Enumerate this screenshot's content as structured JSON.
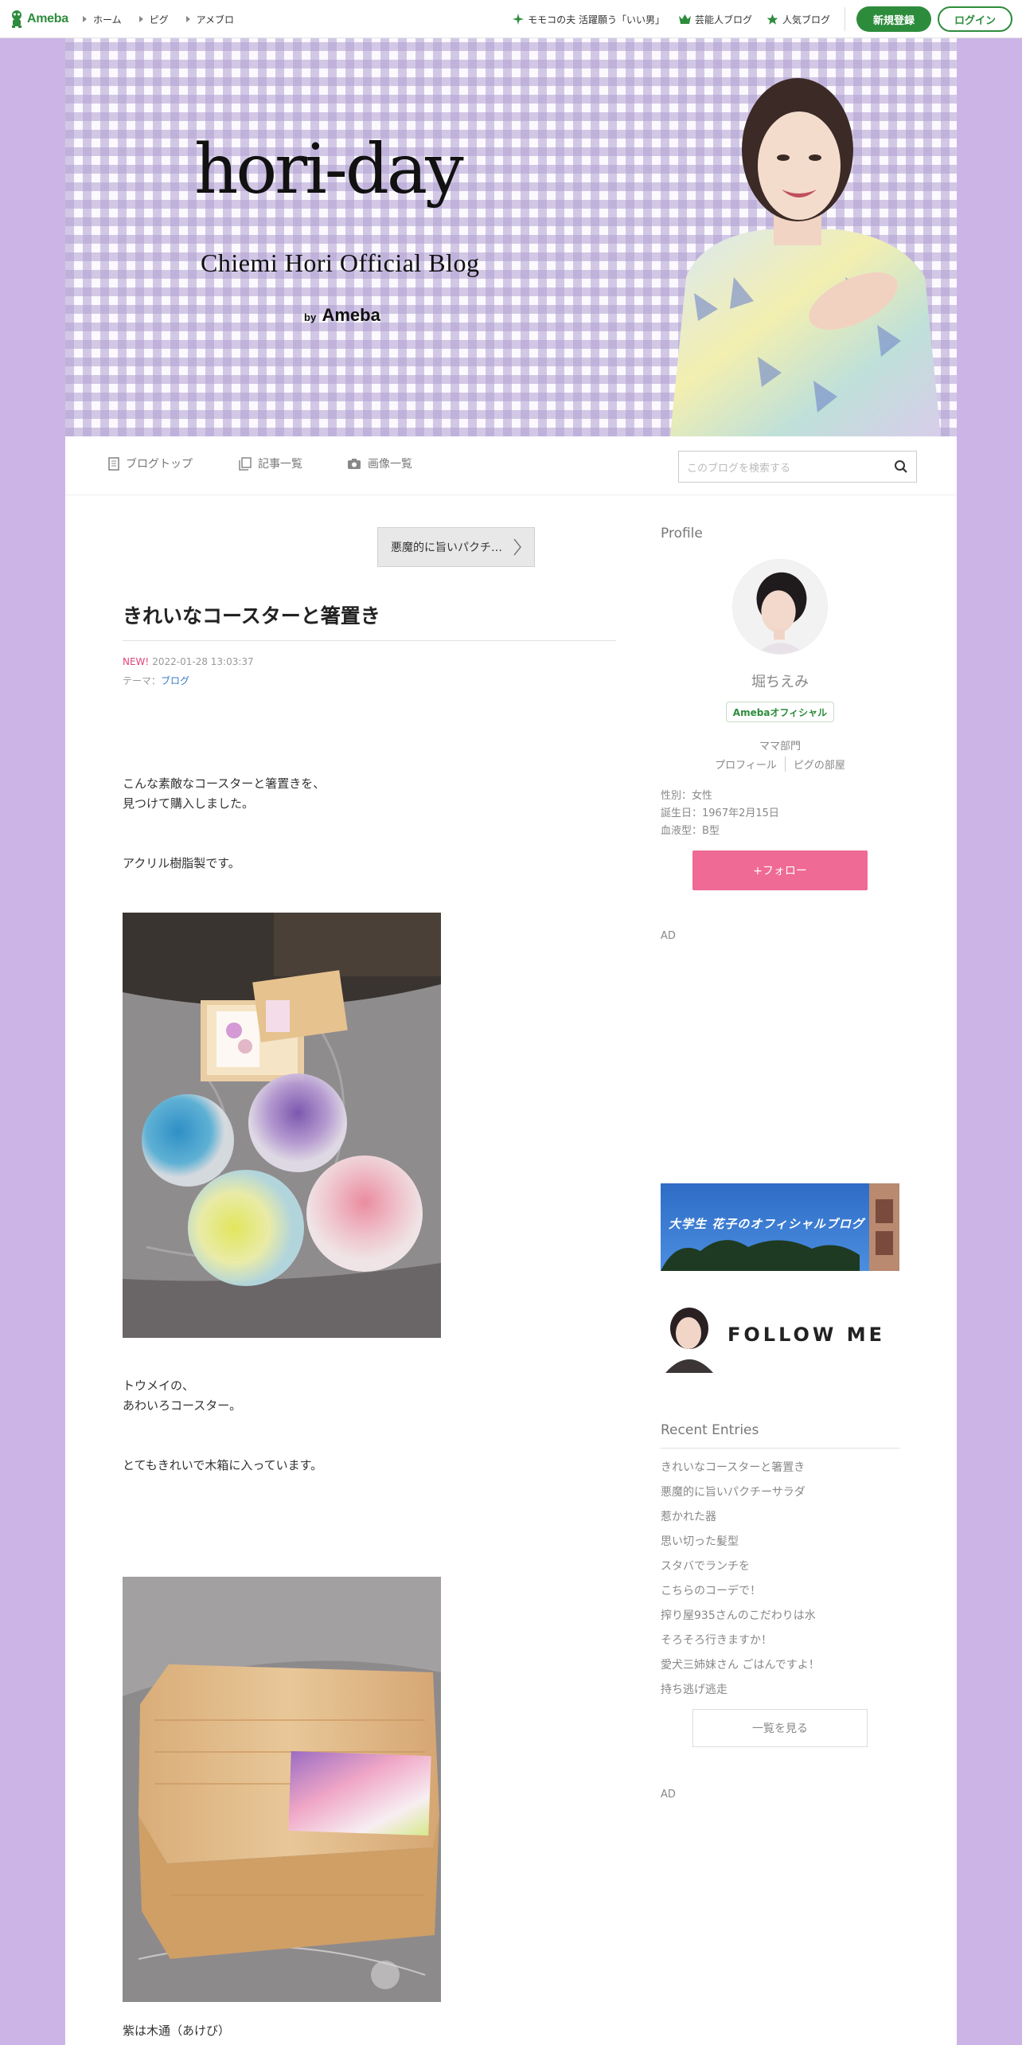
{
  "global_header": {
    "logo_text": "Ameba",
    "nav": [
      "ホーム",
      "ピグ",
      "アメブロ"
    ],
    "picks": [
      "モモコの夫 活躍願う「いい男」",
      "芸能人ブログ",
      "人気ブログ"
    ],
    "signup_label": "新規登録",
    "login_label": "ログイン",
    "brand_color": "#2d8c3c"
  },
  "hero": {
    "title": "hori-day",
    "subtitle": "Chiemi Hori Official Blog",
    "by_prefix": "by",
    "by_brand": "Ameba"
  },
  "blog_nav": {
    "items": [
      "ブログトップ",
      "記事一覧",
      "画像一覧"
    ],
    "search_placeholder": "このブログを検索する"
  },
  "post": {
    "prev_label": "悪魔的に旨いパクチ…",
    "title": "きれいなコースターと箸置き",
    "new_badge": "NEW!",
    "datetime": "2022-01-28 13:03:37",
    "theme_prefix": "テーマ：",
    "theme": "ブログ",
    "paragraphs": [
      "こんな素敵なコースターと箸置きを、",
      "見つけて購入しました。",
      "アクリル樹脂製です。",
      "トウメイの、",
      "あわいろコースター。",
      "とてもきれいで木箱に入っています。",
      "紫は木通（あけび）"
    ]
  },
  "sidebar": {
    "profile_heading": "Profile",
    "name": "堀ちえみ",
    "badge": "Amebaオフィシャル",
    "category": "ママ部門",
    "links": [
      "プロフィール",
      "ピグの部屋"
    ],
    "info": [
      "性別：女性",
      "誕生日：1967年2月15日",
      "血液型：B型"
    ],
    "follow_label": "+フォロー",
    "ad_label": "AD",
    "banner_text": "大学生 花子のオフィシャルブログ",
    "follow_me_text": "FOLLOW ME",
    "recent_heading": "Recent Entries",
    "recent_entries": [
      "きれいなコースターと箸置き",
      "悪魔的に旨いパクチーサラダ",
      "惹かれた器",
      "思い切った髪型",
      "スタバでランチを",
      "こちらのコーデで！",
      "搾り屋935さんのこだわりは水",
      "そろそろ行きますか！",
      "愛犬三姉妹さん ごはんですよ！",
      "持ち逃げ逃走"
    ],
    "more_label": "一覧を見る",
    "follow_color": "#ef6a95"
  }
}
